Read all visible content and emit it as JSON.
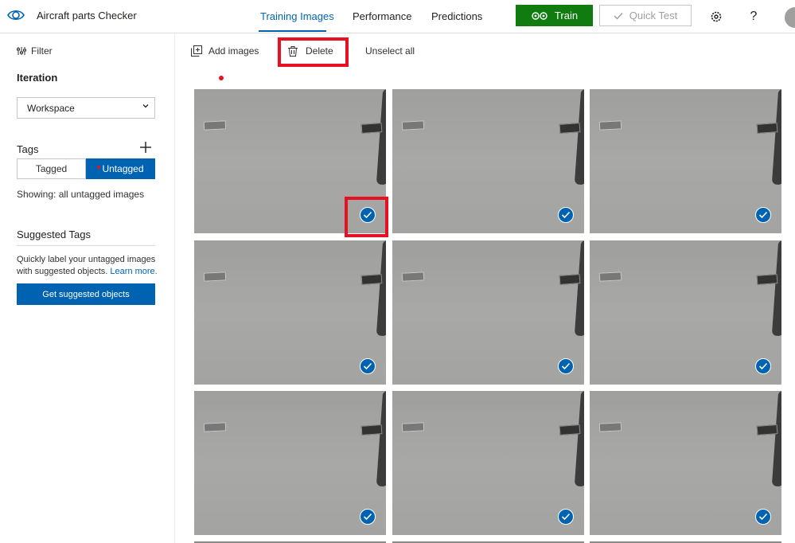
{
  "header": {
    "app_title": "Aircraft parts Checker",
    "tabs": [
      {
        "label": "Training Images",
        "active": true
      },
      {
        "label": "Performance",
        "active": false
      },
      {
        "label": "Predictions",
        "active": false
      }
    ],
    "train_label": "Train",
    "quick_test_label": "Quick Test",
    "help_label": "?"
  },
  "sidebar": {
    "filter_label": "Filter",
    "iteration_heading": "Iteration",
    "iteration_value": "Workspace",
    "tags_heading": "Tags",
    "tagged_label": "Tagged",
    "untagged_label": "Untagged",
    "showing_text": "Showing: all untagged images",
    "suggested_heading": "Suggested Tags",
    "suggested_desc": "Quickly label your untagged images with suggested objects.",
    "learn_more": "Learn more.",
    "suggested_button": "Get suggested objects"
  },
  "toolbar": {
    "add_images": "Add images",
    "delete": "Delete",
    "unselect_all": "Unselect all"
  },
  "colors": {
    "accent": "#0063b1",
    "train_green": "#107c10",
    "highlight_red": "#e81123"
  },
  "images": {
    "count_visible": 9,
    "all_selected": true
  }
}
